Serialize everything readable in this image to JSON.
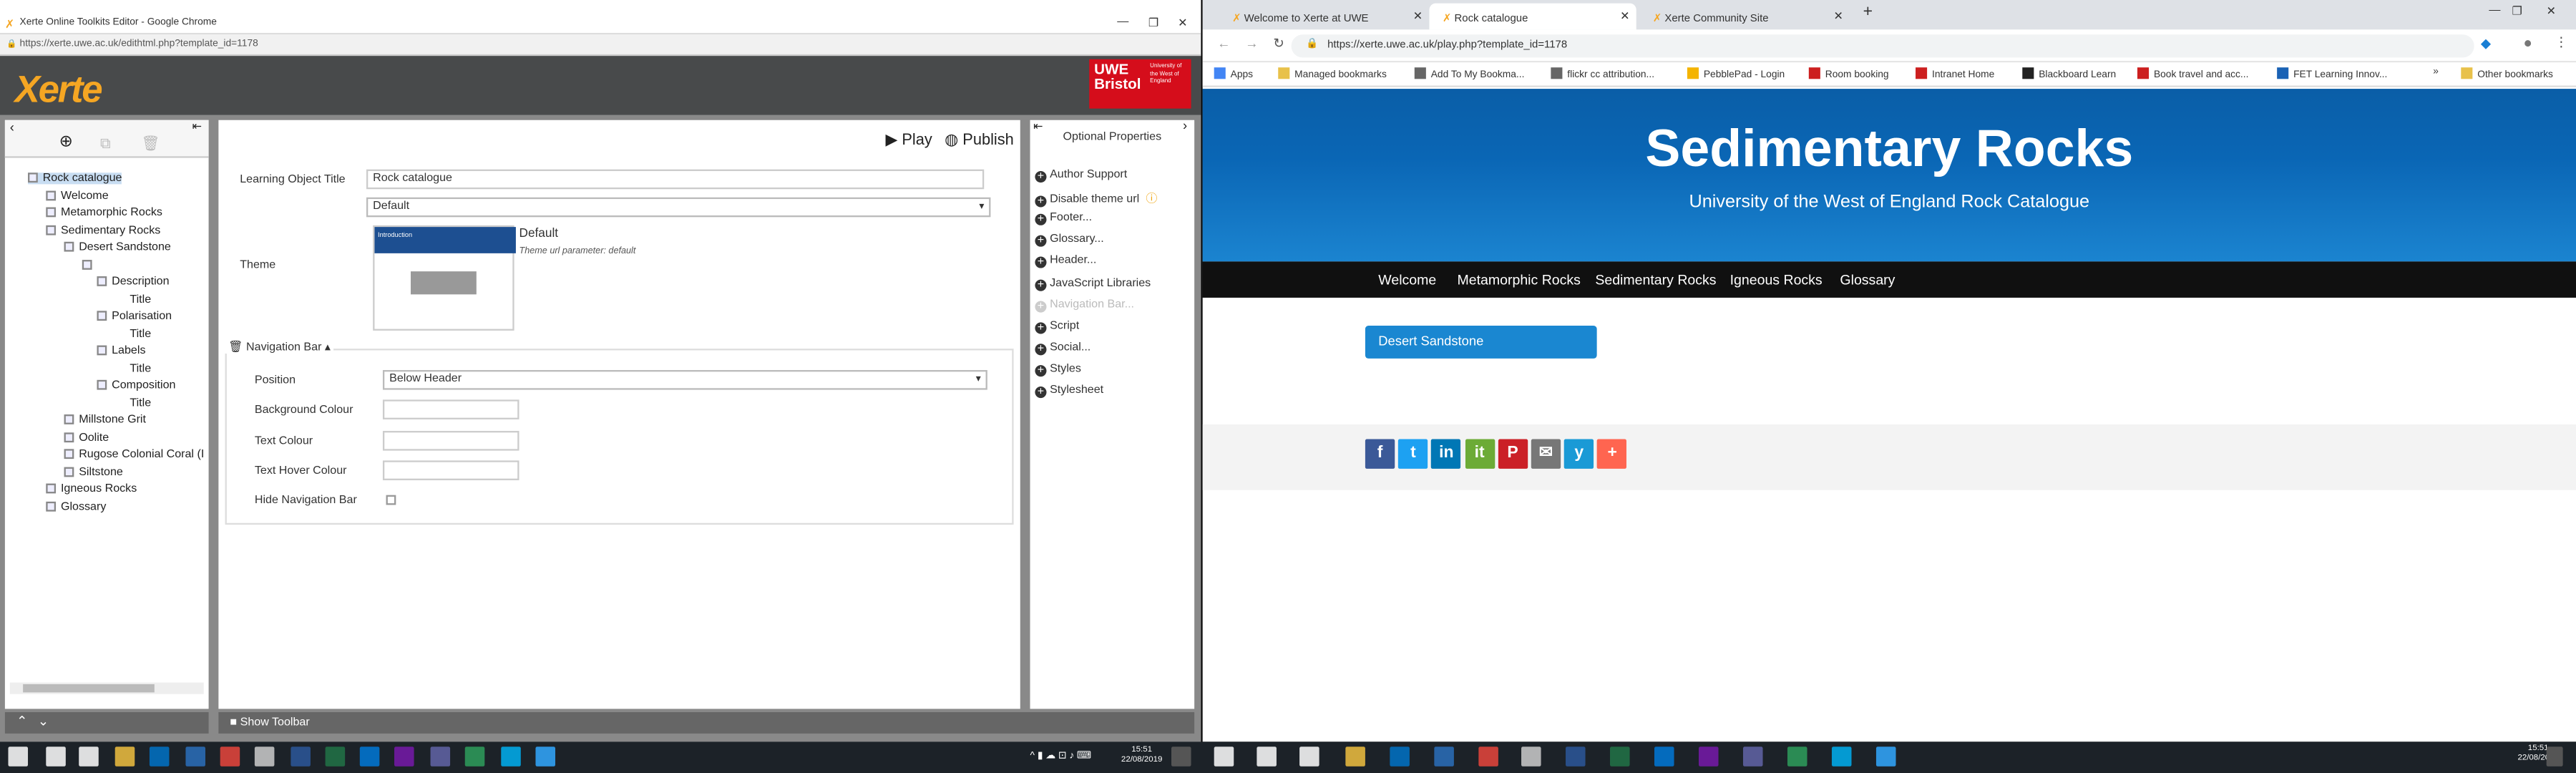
{
  "left_window": {
    "title": "Xerte Online Toolkits Editor - Google Chrome",
    "url": "https://xerte.uwe.ac.uk/edithtml.php?template_id=1178",
    "logo": "Xerte",
    "uwe_logo": {
      "line1": "UWE",
      "line2": "Bristol",
      "small": "University of the West of England"
    },
    "tree": [
      {
        "label": "Rock catalogue",
        "level": 0,
        "selected": true
      },
      {
        "label": "Welcome",
        "level": 1
      },
      {
        "label": "Metamorphic Rocks",
        "level": 1
      },
      {
        "label": "Sedimentary Rocks",
        "level": 1
      },
      {
        "label": "Desert Sandstone",
        "level": 2
      },
      {
        "label": "",
        "level": 3
      },
      {
        "label": "Description",
        "level": 4
      },
      {
        "label": "Title",
        "level": 5
      },
      {
        "label": "Polarisation",
        "level": 4
      },
      {
        "label": "Title",
        "level": 5
      },
      {
        "label": "Labels",
        "level": 4
      },
      {
        "label": "Title",
        "level": 5
      },
      {
        "label": "Composition",
        "level": 4
      },
      {
        "label": "Title",
        "level": 5
      },
      {
        "label": "Millstone Grit",
        "level": 2
      },
      {
        "label": "Oolite",
        "level": 2
      },
      {
        "label": "Rugose Colonial Coral (I",
        "level": 2
      },
      {
        "label": "Siltstone",
        "level": 2
      },
      {
        "label": "Igneous Rocks",
        "level": 1
      },
      {
        "label": "Glossary",
        "level": 1
      }
    ],
    "play_label": "Play",
    "publish_label": "Publish",
    "lo_title_label": "Learning Object Title",
    "lo_title_value": "Rock catalogue",
    "theme_select": "Default",
    "theme_label": "Theme",
    "theme_name": "Default",
    "theme_param": "Theme url parameter: default",
    "thumb_heading": "Introduction",
    "nav_section": "Navigation Bar",
    "position_label": "Position",
    "position_value": "Below Header",
    "bg_colour_label": "Background Colour",
    "text_colour_label": "Text Colour",
    "text_hover_label": "Text Hover Colour",
    "hide_nav_label": "Hide Navigation Bar",
    "show_toolbar": "Show Toolbar",
    "optional_title": "Optional Properties",
    "optional": [
      {
        "label": "Author Support",
        "disabled": false
      },
      {
        "label": "Disable theme url",
        "disabled": false
      },
      {
        "label": "Footer...",
        "disabled": false
      },
      {
        "label": "Glossary...",
        "disabled": false
      },
      {
        "label": "Header...",
        "disabled": false
      },
      {
        "label": "JavaScript Libraries",
        "disabled": false
      },
      {
        "label": "Navigation Bar...",
        "disabled": true
      },
      {
        "label": "Script",
        "disabled": false
      },
      {
        "label": "Social...",
        "disabled": false
      },
      {
        "label": "Styles",
        "disabled": false
      },
      {
        "label": "Stylesheet",
        "disabled": false
      }
    ],
    "taskbar_time": "15:51",
    "taskbar_date": "22/08/2019"
  },
  "right_window": {
    "tabs": [
      {
        "label": "Welcome to Xerte at UWE",
        "active": false
      },
      {
        "label": "Rock catalogue",
        "active": true
      },
      {
        "label": "Xerte Community Site",
        "active": false
      }
    ],
    "url": "https://xerte.uwe.ac.uk/play.php?template_id=1178",
    "bookmarks": [
      "Apps",
      "Managed bookmarks",
      "Add To My Bookma...",
      "flickr cc attribution...",
      "PebblePad - Login",
      "Room booking",
      "Intranet Home",
      "Blackboard Learn",
      "Book travel and acc...",
      "FET Learning Innov...",
      "Other bookmarks"
    ],
    "site_title": "Sedimentary Rocks",
    "site_subtitle": "University of the West of England Rock Catalogue",
    "nav": [
      "Welcome",
      "Metamorphic Rocks",
      "Sedimentary Rocks",
      "Igneous Rocks",
      "Glossary"
    ],
    "page_button": "Desert Sandstone",
    "share": [
      {
        "icon": "facebook-icon",
        "glyph": "f",
        "color": "#3b5998"
      },
      {
        "icon": "twitter-icon",
        "glyph": "t",
        "color": "#1da1f2"
      },
      {
        "icon": "linkedin-icon",
        "glyph": "in",
        "color": "#0077b5"
      },
      {
        "icon": "scoopit-icon",
        "glyph": "it",
        "color": "#6cab36"
      },
      {
        "icon": "pinterest-icon",
        "glyph": "P",
        "color": "#cb2027"
      },
      {
        "icon": "email-icon",
        "glyph": "✉",
        "color": "#777777"
      },
      {
        "icon": "yammer-icon",
        "glyph": "y",
        "color": "#1a9ad6"
      },
      {
        "icon": "more-icon",
        "glyph": "+",
        "color": "#ff6550"
      }
    ],
    "taskbar_time": "15:51",
    "taskbar_date": "22/08/2019"
  },
  "colors": {
    "xerte_orange": "#f5a623",
    "uwe_red": "#d50d1b",
    "banner_blue": "#0a5ea7",
    "button_blue": "#1a87d1"
  }
}
